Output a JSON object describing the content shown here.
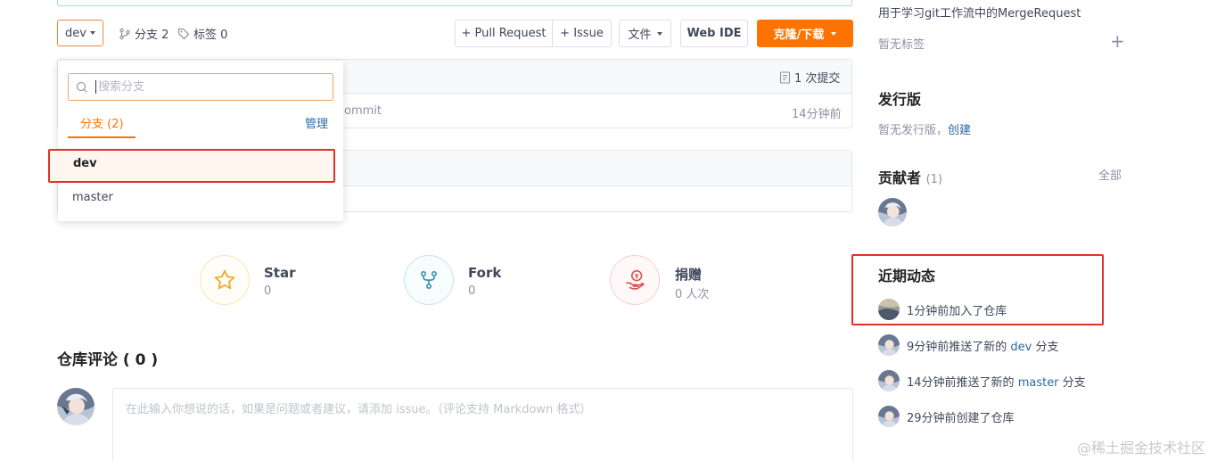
{
  "toolbar": {
    "branch_current": "dev",
    "branches_label": "分支 2",
    "tags_label": "标签 0",
    "pull_request_label": "+ Pull Request",
    "issue_label": "+ Issue",
    "files_label": "文件",
    "web_ide_label": "Web IDE",
    "clone_label": "克隆/下载"
  },
  "file_list": {
    "commits_label": "1 次提交",
    "commit_message_fragment": "ommit",
    "commit_time": "14分钟前"
  },
  "branch_dropdown": {
    "search_placeholder": "搜索分支",
    "tab_label": "分支 (2)",
    "manage_label": "管理",
    "branches": [
      {
        "name": "dev",
        "active": true
      },
      {
        "name": "master",
        "active": false
      }
    ]
  },
  "stats": {
    "star": {
      "label": "Star",
      "value": "0"
    },
    "fork": {
      "label": "Fork",
      "value": "0"
    },
    "donate": {
      "label": "捐赠",
      "value": "0 人次"
    }
  },
  "comments": {
    "title": "仓库评论 ( 0 )",
    "placeholder": "在此输入你想说的话，如果是问题或者建议，请添加 issue。（评论支持 Markdown 格式）"
  },
  "sidebar": {
    "description": "用于学习git工作流中的MergeRequest",
    "no_tags": "暂无标签",
    "releases_title": "发行版",
    "no_releases": "暂无发行版，",
    "create_link": "创建",
    "contributors_title": "贡献者",
    "contributors_count": "(1)",
    "all_link": "全部",
    "activity_title": "近期动态",
    "activities": [
      {
        "prefix": "1分钟前加入了仓库",
        "link": "",
        "suffix": ""
      },
      {
        "prefix": "9分钟前推送了新的 ",
        "link": "dev",
        "suffix": " 分支"
      },
      {
        "prefix": "14分钟前推送了新的 ",
        "link": "master",
        "suffix": " 分支"
      },
      {
        "prefix": "29分钟前创建了仓库",
        "link": "",
        "suffix": ""
      }
    ]
  },
  "watermark": "@稀土掘金技术社区",
  "colors": {
    "accent": "#fe7300",
    "link": "#2c69a7",
    "highlight_border": "#e0302a"
  }
}
